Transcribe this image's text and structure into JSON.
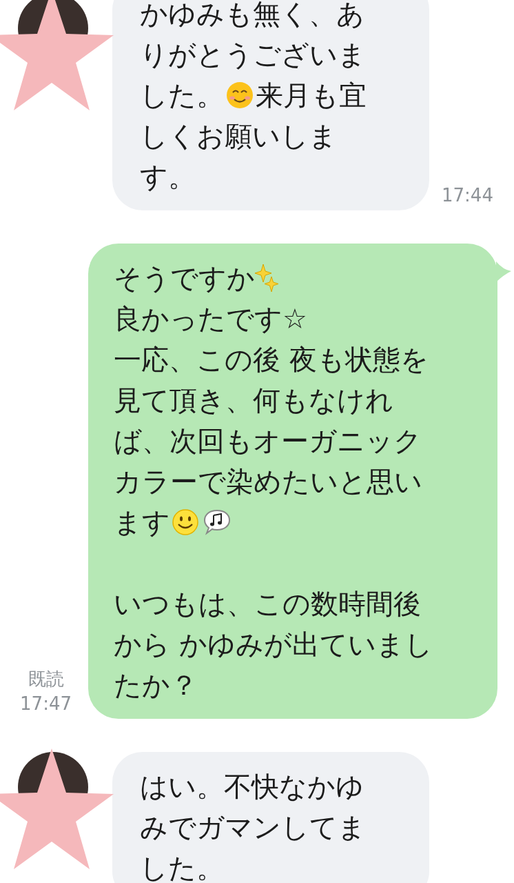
{
  "messages": [
    {
      "kind": "incoming",
      "paragraphs": [
        [
          [
            {
              "kind": "text",
              "text": "かゆみも無く、あ"
            }
          ],
          [
            {
              "kind": "text",
              "text": "りがとうございま"
            }
          ],
          [
            {
              "kind": "text",
              "text": "した。"
            },
            {
              "kind": "blush"
            },
            {
              "kind": "text",
              "text": "来月も宜"
            }
          ],
          [
            {
              "kind": "text",
              "text": "しくお願いしま"
            }
          ],
          [
            {
              "kind": "text",
              "text": "す。"
            }
          ]
        ]
      ],
      "time": "17:44"
    },
    {
      "kind": "outgoing",
      "paragraphs": [
        [
          [
            {
              "kind": "text",
              "text": "そうですか"
            },
            {
              "kind": "sparkles"
            }
          ],
          [
            {
              "kind": "text",
              "text": "良かったです☆"
            }
          ],
          [
            {
              "kind": "text",
              "text": "一応、この後 夜も状態を"
            }
          ],
          [
            {
              "kind": "text",
              "text": "見て頂き、何もなけれ"
            }
          ],
          [
            {
              "kind": "text",
              "text": "ば、次回もオーガニック"
            }
          ],
          [
            {
              "kind": "text",
              "text": "カラーで染めたいと思い"
            }
          ],
          [
            {
              "kind": "text",
              "text": "ます"
            },
            {
              "kind": "smiley"
            },
            {
              "kind": "music"
            }
          ]
        ],
        [
          [
            {
              "kind": "text",
              "text": "いつもは、この数時間後"
            }
          ],
          [
            {
              "kind": "text",
              "text": "から かゆみが出ていまし"
            }
          ],
          [
            {
              "kind": "text",
              "text": "たか？"
            }
          ]
        ]
      ],
      "read": "既読",
      "time": "17:47"
    },
    {
      "kind": "incoming",
      "paragraphs": [
        [
          [
            {
              "kind": "text",
              "text": "はい。不快なかゆ"
            }
          ],
          [
            {
              "kind": "text",
              "text": "みでガマンしてま"
            }
          ],
          [
            {
              "kind": "text",
              "text": "した。"
            }
          ]
        ]
      ]
    }
  ]
}
